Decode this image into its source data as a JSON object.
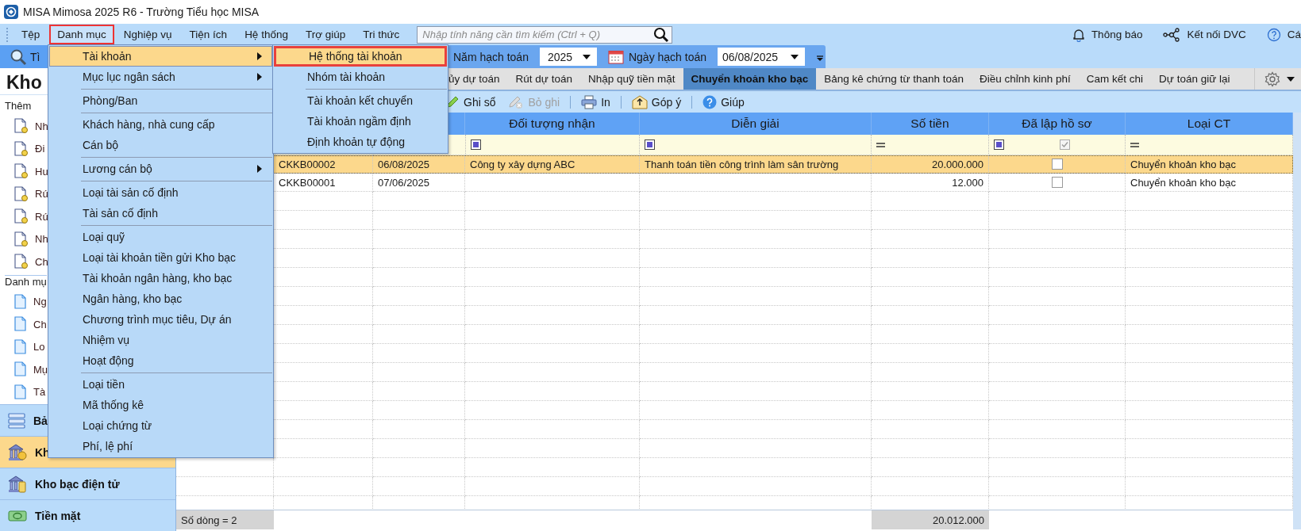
{
  "window": {
    "title": "MISA Mimosa 2025 R6 - Trường Tiểu học MISA"
  },
  "menubar": {
    "items": [
      {
        "label": "Tệp",
        "selected": false
      },
      {
        "label": "Danh mục",
        "selected": true
      },
      {
        "label": "Nghiệp vụ",
        "selected": false
      },
      {
        "label": "Tiện ích",
        "selected": false
      },
      {
        "label": "Hệ thống",
        "selected": false
      },
      {
        "label": "Trợ giúp",
        "selected": false
      },
      {
        "label": "Tri thức",
        "selected": false
      }
    ],
    "search": {
      "placeholder": "Nhập tính năng cần tìm kiếm (Ctrl + Q)"
    },
    "right": [
      {
        "kind": "bell",
        "label": "Thông báo"
      },
      {
        "kind": "connect",
        "label": "Kết nối DVC"
      },
      {
        "kind": "help",
        "label": "Cá"
      }
    ]
  },
  "toolbar": {
    "search_label": "Tì",
    "fields": [
      {
        "kind": "year",
        "label": "Năm hạch toán",
        "value": "2025"
      },
      {
        "kind": "date",
        "label": "Ngày hạch toán",
        "value": "06/08/2025"
      }
    ]
  },
  "sidebar": {
    "heading": "Kho",
    "groups": [
      {
        "label": "Thêm",
        "kind": "pending",
        "items": [
          "Nh",
          "Đi",
          "Hư",
          "Rú",
          "Rú",
          "Nh",
          "Ch"
        ]
      },
      {
        "label": "Danh mụ",
        "kind": "document",
        "items": [
          "Ng",
          "Ch",
          "Lo",
          "Mụ",
          "Tà"
        ]
      }
    ],
    "nav": [
      {
        "kind": "list",
        "label": "Bả",
        "selected": false
      },
      {
        "kind": "bank",
        "label": "Kh",
        "selected": true
      },
      {
        "kind": "ebank",
        "label": "Kho bạc điện tử",
        "selected": false
      },
      {
        "kind": "cash",
        "label": "Tiền mặt",
        "selected": false
      }
    ]
  },
  "tabs": [
    {
      "label": "ủy dự toán",
      "selected": false
    },
    {
      "label": "Rút dự toán",
      "selected": false
    },
    {
      "label": "Nhập quỹ tiền mặt",
      "selected": false
    },
    {
      "label": "Chuyển khoản kho bạc",
      "selected": true
    },
    {
      "label": "Bảng kê chứng từ thanh toán",
      "selected": false
    },
    {
      "label": "Điều chỉnh kinh phí",
      "selected": false
    },
    {
      "label": "Cam kết chi",
      "selected": false
    },
    {
      "label": "Dự toán giữ lại",
      "selected": false
    }
  ],
  "actions": [
    {
      "kind": "post",
      "label": "Ghi sổ",
      "disabled": false,
      "separator_before": false
    },
    {
      "kind": "unpost",
      "label": "Bỏ ghi",
      "disabled": true,
      "separator_before": false
    },
    {
      "kind": "print",
      "label": "In",
      "disabled": false,
      "separator_before": true
    },
    {
      "kind": "feedback",
      "label": "Góp ý",
      "disabled": false,
      "separator_before": true
    },
    {
      "kind": "help",
      "label": "Giúp",
      "disabled": false,
      "separator_before": true
    }
  ],
  "table": {
    "columns": [
      "",
      "",
      "Đối tượng nhận",
      "Diễn giải",
      "Số tiền",
      "Đã lập hồ sơ",
      "Loại CT"
    ],
    "filter": {
      "record_checked": true
    },
    "rows": [
      {
        "selected": true,
        "cells": [
          "CKKB00002",
          "06/08/2025",
          "Công ty xây dựng ABC",
          "Thanh toán tiền công trình làm sân trường",
          "20.000.000"
        ],
        "filed": false,
        "type": "Chuyển khoản kho bạc"
      },
      {
        "selected": false,
        "cells": [
          "CKKB00001",
          "07/06/2025",
          "",
          "",
          "12.000"
        ],
        "filed": false,
        "type": "Chuyển khoản kho bạc"
      }
    ],
    "footer": {
      "count": "Số dòng = 2",
      "total": "20.012.000"
    }
  },
  "menu": {
    "items": [
      {
        "kind": "item",
        "label": "Tài khoản",
        "submenu": true,
        "selected": true
      },
      {
        "kind": "item",
        "label": "Mục lục ngân sách",
        "submenu": true,
        "selected": false
      },
      {
        "kind": "separator"
      },
      {
        "kind": "item",
        "label": "Phòng/Ban",
        "submenu": false,
        "selected": false
      },
      {
        "kind": "separator"
      },
      {
        "kind": "item",
        "label": "Khách hàng, nhà cung cấp",
        "submenu": false,
        "selected": false
      },
      {
        "kind": "item",
        "label": "Cán bộ",
        "submenu": false,
        "selected": false
      },
      {
        "kind": "separator"
      },
      {
        "kind": "item",
        "label": "Lương cán bộ",
        "submenu": true,
        "selected": false
      },
      {
        "kind": "separator"
      },
      {
        "kind": "item",
        "label": "Loại tài sản cố định",
        "submenu": false,
        "selected": false
      },
      {
        "kind": "item",
        "label": "Tài sản cố định",
        "submenu": false,
        "selected": false
      },
      {
        "kind": "separator"
      },
      {
        "kind": "item",
        "label": "Loại quỹ",
        "submenu": false,
        "selected": false
      },
      {
        "kind": "item",
        "label": "Loại tài khoản tiền gửi Kho bạc",
        "submenu": false,
        "selected": false
      },
      {
        "kind": "item",
        "label": "Tài khoản ngân hàng, kho bạc",
        "submenu": false,
        "selected": false
      },
      {
        "kind": "item",
        "label": "Ngân hàng, kho bạc",
        "submenu": false,
        "selected": false
      },
      {
        "kind": "item",
        "label": "Chương trình mục tiêu, Dự án",
        "submenu": false,
        "selected": false
      },
      {
        "kind": "item",
        "label": "Nhiệm vụ",
        "submenu": false,
        "selected": false
      },
      {
        "kind": "item",
        "label": "Hoạt động",
        "submenu": false,
        "selected": false
      },
      {
        "kind": "separator"
      },
      {
        "kind": "item",
        "label": "Loại tiền",
        "submenu": false,
        "selected": false
      },
      {
        "kind": "item",
        "label": "Mã thống kê",
        "submenu": false,
        "selected": false
      },
      {
        "kind": "item",
        "label": "Loại chứng từ",
        "submenu": false,
        "selected": false
      },
      {
        "kind": "item",
        "label": "Phí, lệ phí",
        "submenu": false,
        "selected": false
      }
    ]
  },
  "submenu": {
    "items": [
      {
        "kind": "item",
        "label": "Hệ thống tài khoản",
        "selected": true
      },
      {
        "kind": "item",
        "label": "Nhóm tài khoản",
        "selected": false
      },
      {
        "kind": "separator"
      },
      {
        "kind": "item",
        "label": "Tài khoản kết chuyển",
        "selected": false
      },
      {
        "kind": "item",
        "label": "Tài khoản ngầm định",
        "selected": false
      },
      {
        "kind": "item",
        "label": "Định khoản tự động",
        "selected": false
      }
    ]
  }
}
